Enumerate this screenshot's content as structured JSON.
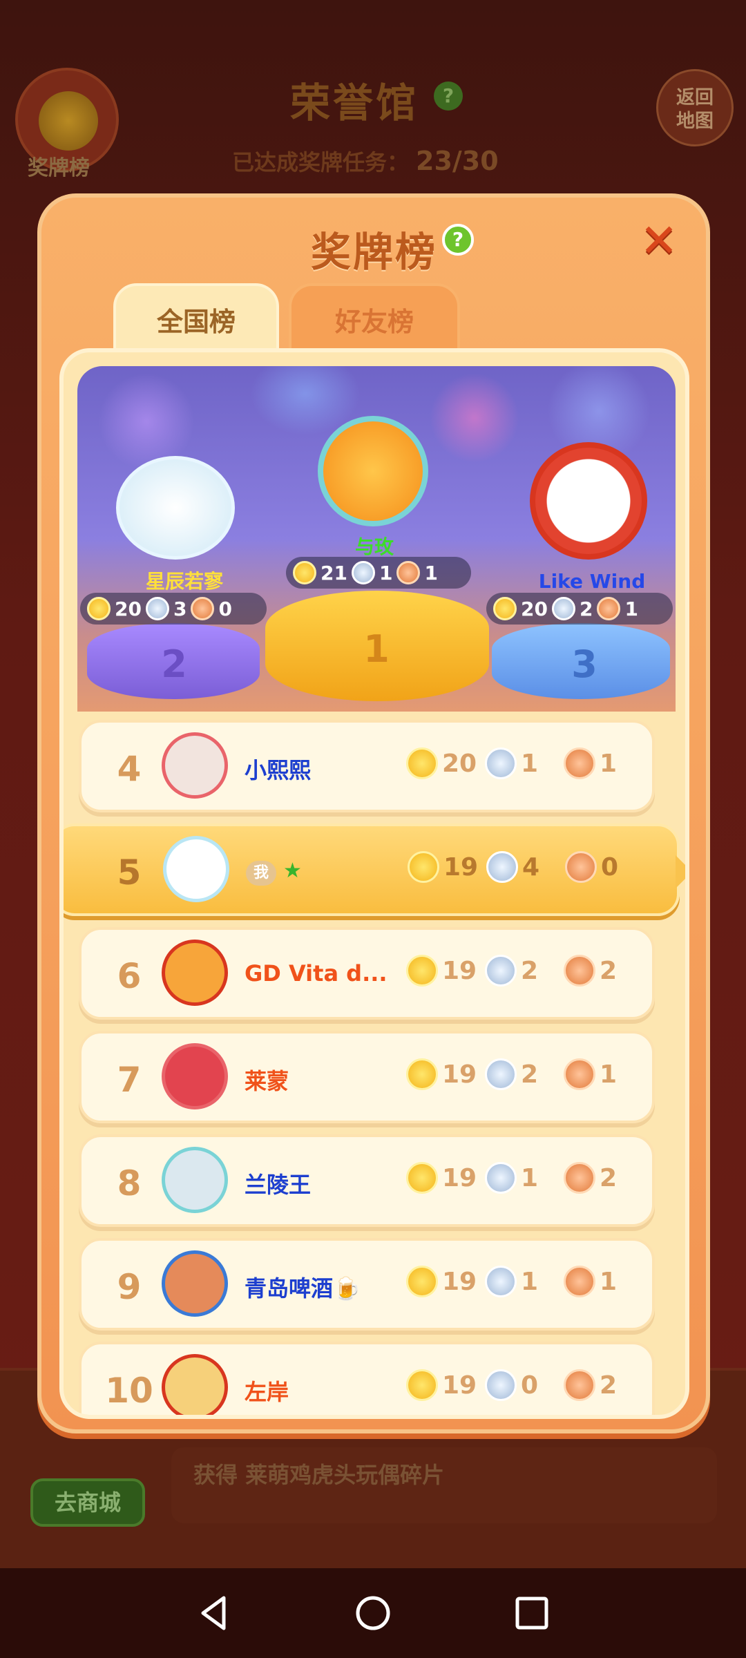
{
  "background": {
    "badge_button_label": "奖牌榜",
    "hall_title": "荣誉馆",
    "hall_help": "?",
    "back_button_label": "返回地图",
    "progress_label": "已达成奖牌任务：",
    "progress_value": "23/30",
    "shop_button_label": "去商城",
    "reward_text": "获得 莱萌鸡虎头玩偶碎片"
  },
  "modal": {
    "title": "奖牌榜",
    "help": "?",
    "close": "✕",
    "tabs": [
      {
        "label": "全国榜",
        "active": true
      },
      {
        "label": "好友榜",
        "active": false
      }
    ]
  },
  "podium": [
    {
      "rank": "1",
      "name": "与玫",
      "gold": "21",
      "silver": "1",
      "bronze": "1"
    },
    {
      "rank": "2",
      "name": "星辰若寥",
      "gold": "20",
      "silver": "3",
      "bronze": "0"
    },
    {
      "rank": "3",
      "name": "Like  Wind",
      "gold": "20",
      "silver": "2",
      "bronze": "1"
    }
  ],
  "rows": [
    {
      "rank": "4",
      "name": "小熙熙",
      "name_color": "#1d3fcf",
      "gold": "20",
      "silver": "1",
      "bronze": "1"
    },
    {
      "rank": "5",
      "name": "我",
      "is_me": true,
      "gold": "19",
      "silver": "4",
      "bronze": "0"
    },
    {
      "rank": "6",
      "name": "GD Vita d...",
      "name_color": "#f0521a",
      "gold": "19",
      "silver": "2",
      "bronze": "2"
    },
    {
      "rank": "7",
      "name": "莱蒙",
      "name_color": "#f0521a",
      "gold": "19",
      "silver": "2",
      "bronze": "1"
    },
    {
      "rank": "8",
      "name": "兰陵王",
      "name_color": "#1d3fcf",
      "gold": "19",
      "silver": "1",
      "bronze": "2"
    },
    {
      "rank": "9",
      "name": "青岛啤酒🍺",
      "name_color": "#1d3fcf",
      "gold": "19",
      "silver": "1",
      "bronze": "1"
    },
    {
      "rank": "10",
      "name": "左岸",
      "name_color": "#f0521a",
      "gold": "19",
      "silver": "0",
      "bronze": "2"
    }
  ],
  "colors": {
    "accent_orange": "#f29351",
    "board_bg": "#fde6b1",
    "me_row": "#f9bd3f"
  }
}
